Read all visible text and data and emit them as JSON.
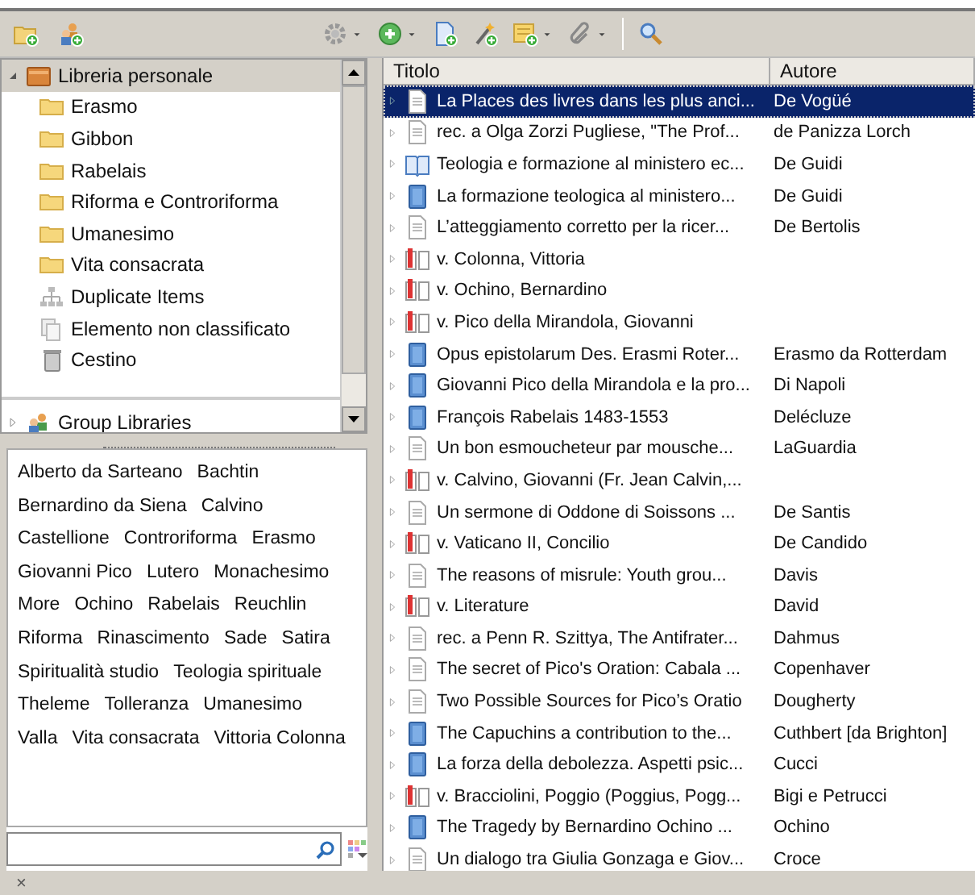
{
  "toolbar": {
    "left": [
      {
        "kind": "new-collection"
      },
      {
        "kind": "new-group"
      }
    ],
    "right": [
      {
        "kind": "gear",
        "menu": true
      },
      {
        "kind": "new-item",
        "menu": true
      },
      {
        "kind": "add-by-id",
        "menu": false
      },
      {
        "kind": "wand",
        "menu": false
      },
      {
        "kind": "note",
        "menu": true
      },
      {
        "kind": "attach",
        "menu": true
      },
      {
        "kind": "search",
        "menu": false
      }
    ]
  },
  "collections": [
    {
      "label": "Libreria personale",
      "kind": "library",
      "expanded": true,
      "selected": true,
      "children": [
        {
          "label": "Erasmo",
          "kind": "folder",
          "selected": false
        },
        {
          "label": "Gibbon",
          "kind": "folder",
          "selected": false
        },
        {
          "label": "Rabelais",
          "kind": "folder",
          "selected": false
        },
        {
          "label": "Riforma e Controriforma",
          "kind": "folder",
          "selected": false
        },
        {
          "label": "Umanesimo",
          "kind": "folder",
          "selected": false
        },
        {
          "label": "Vita consacrata",
          "kind": "folder",
          "selected": false
        },
        {
          "label": "Duplicate Items",
          "kind": "duplicates",
          "selected": false
        },
        {
          "label": "Elemento non classificato",
          "kind": "unfiled",
          "selected": false
        },
        {
          "label": "Cestino",
          "kind": "trash",
          "selected": false
        }
      ]
    },
    {
      "label": "Group Libraries",
      "kind": "groups",
      "expanded": false,
      "selected": false
    }
  ],
  "tags": [
    "Alberto da Sarteano",
    "Bachtin",
    "Bernardino da Siena",
    "Calvino",
    "Castellione",
    "Controriforma",
    "Erasmo",
    "Giovanni Pico",
    "Lutero",
    "Monachesimo",
    "More",
    "Ochino",
    "Rabelais",
    "Reuchlin",
    "Riforma",
    "Rinascimento",
    "Sade",
    "Satira",
    "Spiritualità studio",
    "Teologia spirituale",
    "Theleme",
    "Tolleranza",
    "Umanesimo",
    "Valla",
    "Vita consacrata",
    "Vittoria Colonna"
  ],
  "bottom_bar": {
    "close": "×"
  },
  "table": {
    "columns": [
      "Titolo",
      "Autore"
    ],
    "rows": [
      {
        "kind": "document",
        "title": "La Places des livres dans les plus anci...",
        "author": "De Vogüé",
        "selected": true
      },
      {
        "kind": "document",
        "title": "rec. a  Olga Zorzi Pugliese, \"The Prof...",
        "author": "de Panizza Lorch",
        "selected": false
      },
      {
        "kind": "book-section",
        "title": "Teologia e formazione al ministero ec...",
        "author": "De Guidi",
        "selected": false
      },
      {
        "kind": "book",
        "title": "La formazione teologica  al ministero...",
        "author": "De Guidi",
        "selected": false
      },
      {
        "kind": "document",
        "title": "L’atteggiamento corretto per la ricer...",
        "author": "De Bertolis",
        "selected": false
      },
      {
        "kind": "entry",
        "title": "v. Colonna, Vittoria",
        "author": "",
        "selected": false
      },
      {
        "kind": "entry",
        "title": "v. Ochino, Bernardino",
        "author": "",
        "selected": false
      },
      {
        "kind": "entry",
        "title": "v. Pico della Mirandola, Giovanni",
        "author": "",
        "selected": false
      },
      {
        "kind": "book",
        "title": "Opus epistolarum Des. Erasmi Roter...",
        "author": "Erasmo da Rotterdam",
        "selected": false
      },
      {
        "kind": "book",
        "title": "Giovanni Pico della Mirandola e la pro...",
        "author": "Di Napoli",
        "selected": false
      },
      {
        "kind": "book",
        "title": "François Rabelais 1483-1553",
        "author": "Delécluze",
        "selected": false
      },
      {
        "kind": "document",
        "title": "Un bon esmoucheteur par mousche...",
        "author": "LaGuardia",
        "selected": false
      },
      {
        "kind": "entry",
        "title": "v. Calvino, Giovanni (Fr. Jean Calvin,...",
        "author": "",
        "selected": false
      },
      {
        "kind": "document",
        "title": "Un sermone di Oddone di Soissons ...",
        "author": "De Santis",
        "selected": false
      },
      {
        "kind": "entry",
        "title": "v. Vaticano II, Concilio",
        "author": "De Candido",
        "selected": false
      },
      {
        "kind": "document",
        "title": "The reasons of misrule: Youth grou...",
        "author": "Davis",
        "selected": false
      },
      {
        "kind": "entry",
        "title": "v. Literature",
        "author": "David",
        "selected": false
      },
      {
        "kind": "document",
        "title": "rec. a Penn R. Szittya, The Antifrater...",
        "author": "Dahmus",
        "selected": false
      },
      {
        "kind": "document",
        "title": "The secret of Pico's Oration: Cabala ...",
        "author": "Copenhaver",
        "selected": false
      },
      {
        "kind": "document",
        "title": "Two Possible Sources for Pico’s Oratio",
        "author": "Dougherty",
        "selected": false
      },
      {
        "kind": "book",
        "title": "The Capuchins a contribution to the...",
        "author": "Cuthbert [da Brighton]",
        "selected": false
      },
      {
        "kind": "book",
        "title": "La forza della debolezza. Aspetti psic...",
        "author": "Cucci",
        "selected": false
      },
      {
        "kind": "entry",
        "title": "v. Bracciolini, Poggio (Poggius, Pogg...",
        "author": "Bigi e Petrucci",
        "selected": false
      },
      {
        "kind": "book",
        "title": "The Tragedy by Bernardino Ochino ...",
        "author": "Ochino",
        "selected": false
      },
      {
        "kind": "document",
        "title": "Un dialogo tra Giulia Gonzaga e Giov...",
        "author": "Croce",
        "selected": false
      }
    ]
  }
}
